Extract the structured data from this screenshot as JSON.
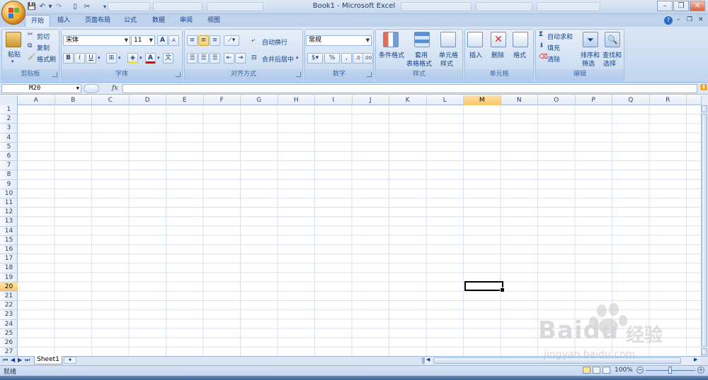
{
  "window": {
    "title": "Book1 - Microsoft Excel"
  },
  "quick_access": [
    "save-icon",
    "undo-icon",
    "redo-icon",
    "new-icon",
    "customize-icon"
  ],
  "tabs": [
    "开始",
    "插入",
    "页面布局",
    "公式",
    "数据",
    "审阅",
    "视图"
  ],
  "active_tab": "开始",
  "ribbon": {
    "clipboard": {
      "label": "剪贴板",
      "paste": "粘贴",
      "cut": "剪切",
      "copy": "复制",
      "format_painter": "格式刷"
    },
    "font": {
      "label": "字体",
      "font_name": "宋体",
      "font_size": "11",
      "bold": "B",
      "italic": "I",
      "underline": "U",
      "grow": "A",
      "shrink": "A"
    },
    "alignment": {
      "label": "对齐方式",
      "wrap_text": "自动换行",
      "merge_center": "合并后居中"
    },
    "number": {
      "label": "数字",
      "format": "常规",
      "percent": "%",
      "comma": ","
    },
    "styles": {
      "label": "样式",
      "conditional": "条件格式",
      "format_table_1": "套用",
      "format_table_2": "表格格式",
      "cell_styles_1": "单元格",
      "cell_styles_2": "样式"
    },
    "cells": {
      "label": "单元格",
      "insert": "插入",
      "delete": "删除",
      "format": "格式"
    },
    "editing": {
      "label": "编辑",
      "autosum": "自动求和",
      "fill": "填充",
      "clear": "清除",
      "sort_1": "排序和",
      "sort_2": "筛选",
      "find_1": "查找和",
      "find_2": "选择"
    }
  },
  "formula_bar": {
    "name_box": "M20",
    "fx": "fx",
    "value": ""
  },
  "columns": [
    "A",
    "B",
    "C",
    "D",
    "E",
    "F",
    "G",
    "H",
    "I",
    "J",
    "K",
    "L",
    "M",
    "N",
    "O",
    "P",
    "Q",
    "R"
  ],
  "rows": [
    "1",
    "2",
    "3",
    "4",
    "5",
    "6",
    "7",
    "8",
    "9",
    "10",
    "11",
    "12",
    "13",
    "14",
    "15",
    "16",
    "17",
    "18",
    "19",
    "20",
    "21",
    "22",
    "23",
    "24",
    "25",
    "26",
    "27"
  ],
  "selected_cell": {
    "column": "M",
    "row": "20"
  },
  "sheet_tabs": [
    "Sheet1"
  ],
  "status": {
    "text": "就绪",
    "zoom": "100%"
  },
  "watermark": {
    "brand": "Baidu",
    "cn": "经验",
    "url": "jingyan.baidu.com"
  },
  "colors": {
    "ribbon": "#c9dbf1",
    "accent": "#15428b",
    "selection": "#f9c56a"
  }
}
